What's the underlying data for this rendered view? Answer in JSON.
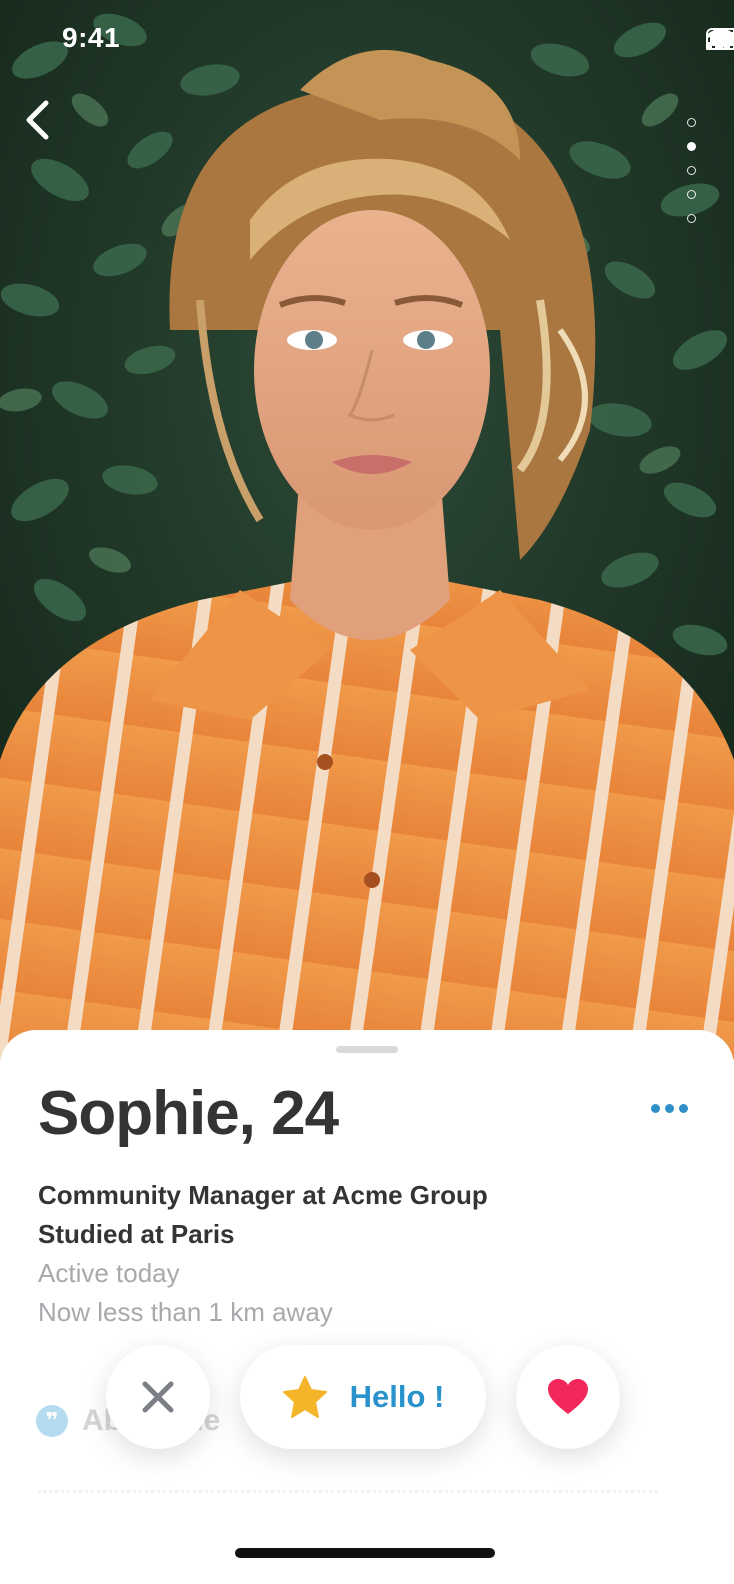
{
  "status_bar": {
    "time": "9:41"
  },
  "photo": {
    "page_count": 5,
    "current_page": 2
  },
  "profile": {
    "name_age": "Sophie, 24",
    "job": "Community Manager at Acme Group",
    "education": "Studied at Paris",
    "activity": "Active today",
    "distance": "Now less than 1 km away"
  },
  "about": {
    "title": "About me"
  },
  "actions": {
    "hello_label": "Hello !"
  },
  "colors": {
    "accent": "#2b93cc",
    "like": "#f2285a",
    "star": "#f5b52a",
    "pass": "#7c7f86"
  }
}
